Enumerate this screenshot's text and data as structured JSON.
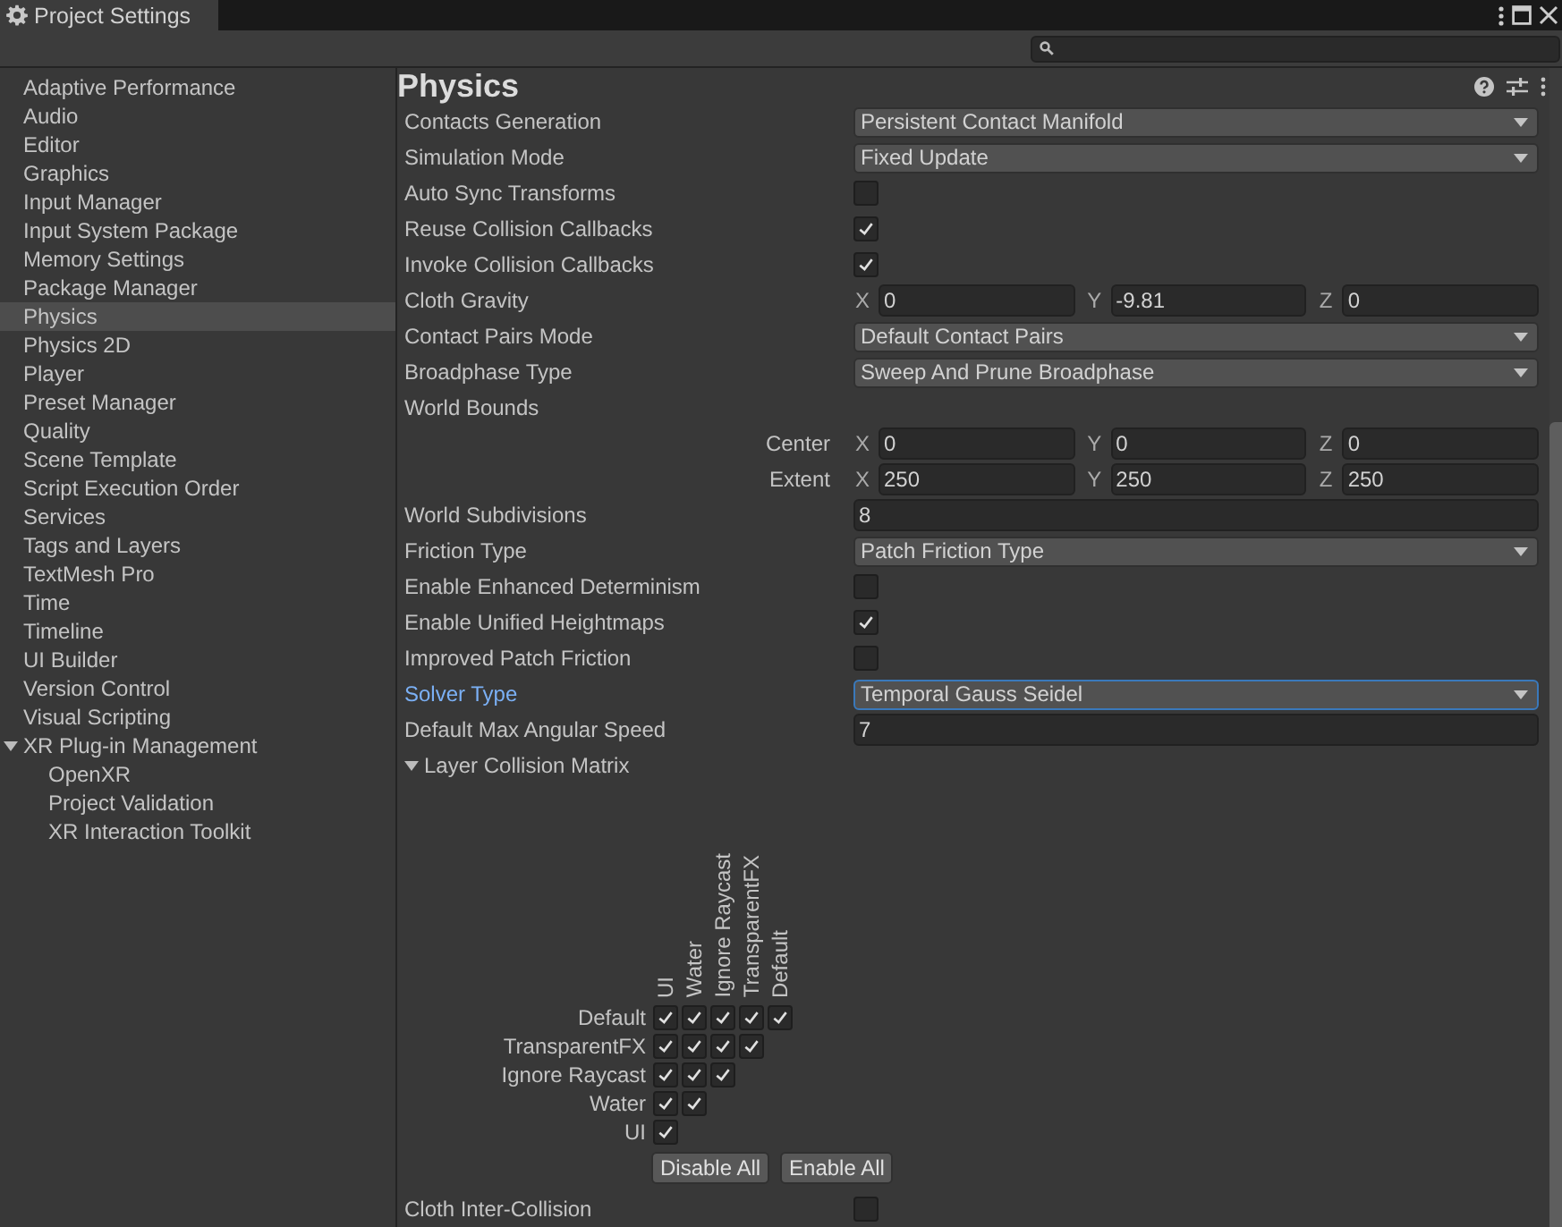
{
  "window": {
    "title": "Project Settings"
  },
  "sidebar": {
    "items": [
      {
        "label": "Adaptive Performance",
        "selected": false
      },
      {
        "label": "Audio",
        "selected": false
      },
      {
        "label": "Editor",
        "selected": false
      },
      {
        "label": "Graphics",
        "selected": false
      },
      {
        "label": "Input Manager",
        "selected": false
      },
      {
        "label": "Input System Package",
        "selected": false
      },
      {
        "label": "Memory Settings",
        "selected": false
      },
      {
        "label": "Package Manager",
        "selected": false
      },
      {
        "label": "Physics",
        "selected": true
      },
      {
        "label": "Physics 2D",
        "selected": false
      },
      {
        "label": "Player",
        "selected": false
      },
      {
        "label": "Preset Manager",
        "selected": false
      },
      {
        "label": "Quality",
        "selected": false
      },
      {
        "label": "Scene Template",
        "selected": false
      },
      {
        "label": "Script Execution Order",
        "selected": false
      },
      {
        "label": "Services",
        "selected": false
      },
      {
        "label": "Tags and Layers",
        "selected": false
      },
      {
        "label": "TextMesh Pro",
        "selected": false
      },
      {
        "label": "Time",
        "selected": false
      },
      {
        "label": "Timeline",
        "selected": false
      },
      {
        "label": "UI Builder",
        "selected": false
      },
      {
        "label": "Version Control",
        "selected": false
      },
      {
        "label": "Visual Scripting",
        "selected": false
      },
      {
        "label": "XR Plug-in Management",
        "selected": false,
        "expanded": true,
        "children": [
          {
            "label": "OpenXR",
            "selected": false
          },
          {
            "label": "Project Validation",
            "selected": false
          },
          {
            "label": "XR Interaction Toolkit",
            "selected": false
          }
        ]
      }
    ]
  },
  "inspector": {
    "title": "Physics",
    "rows": [
      {
        "kind": "dropdown",
        "label": "Contacts Generation",
        "value": "Persistent Contact Manifold",
        "focused": false
      },
      {
        "kind": "dropdown",
        "label": "Simulation Mode",
        "value": "Fixed Update",
        "focused": false
      },
      {
        "kind": "checkbox",
        "label": "Auto Sync Transforms",
        "checked": false
      },
      {
        "kind": "checkbox",
        "label": "Reuse Collision Callbacks",
        "checked": true
      },
      {
        "kind": "checkbox",
        "label": "Invoke Collision Callbacks",
        "checked": true
      },
      {
        "kind": "vector",
        "label": "Cloth Gravity",
        "axes": [
          {
            "axis": "X",
            "value": "0"
          },
          {
            "axis": "Y",
            "value": "-9.81"
          },
          {
            "axis": "Z",
            "value": "0"
          }
        ]
      },
      {
        "kind": "dropdown",
        "label": "Contact Pairs Mode",
        "value": "Default Contact Pairs",
        "focused": false
      },
      {
        "kind": "dropdown",
        "label": "Broadphase Type",
        "value": "Sweep And Prune Broadphase",
        "focused": false
      },
      {
        "kind": "heading",
        "label": "World Bounds"
      },
      {
        "kind": "subvector",
        "label": "Center",
        "axes": [
          {
            "axis": "X",
            "value": "0"
          },
          {
            "axis": "Y",
            "value": "0"
          },
          {
            "axis": "Z",
            "value": "0"
          }
        ]
      },
      {
        "kind": "subvector",
        "label": "Extent",
        "axes": [
          {
            "axis": "X",
            "value": "250"
          },
          {
            "axis": "Y",
            "value": "250"
          },
          {
            "axis": "Z",
            "value": "250"
          }
        ]
      },
      {
        "kind": "text",
        "label": "World Subdivisions",
        "value": "8"
      },
      {
        "kind": "dropdown",
        "label": "Friction Type",
        "value": "Patch Friction Type",
        "focused": false
      },
      {
        "kind": "checkbox",
        "label": "Enable Enhanced Determinism",
        "checked": false
      },
      {
        "kind": "checkbox",
        "label": "Enable Unified Heightmaps",
        "checked": true
      },
      {
        "kind": "checkbox",
        "label": "Improved Patch Friction",
        "checked": false
      },
      {
        "kind": "dropdown",
        "label": "Solver Type",
        "value": "Temporal Gauss Seidel",
        "focused": true
      },
      {
        "kind": "text",
        "label": "Default Max Angular Speed",
        "value": "7"
      }
    ],
    "collision_matrix": {
      "label": "Layer Collision Matrix",
      "expanded": true,
      "columns": [
        "UI",
        "Water",
        "Ignore Raycast",
        "TransparentFX",
        "Default"
      ],
      "rows": [
        {
          "label": "Default",
          "checks": [
            true,
            true,
            true,
            true,
            true
          ]
        },
        {
          "label": "TransparentFX",
          "checks": [
            true,
            true,
            true,
            true
          ]
        },
        {
          "label": "Ignore Raycast",
          "checks": [
            true,
            true,
            true
          ]
        },
        {
          "label": "Water",
          "checks": [
            true,
            true
          ]
        },
        {
          "label": "UI",
          "checks": [
            true
          ]
        }
      ],
      "buttons": [
        "Disable All",
        "Enable All"
      ]
    },
    "after_rows": [
      {
        "kind": "checkbox",
        "label": "Cloth Inter-Collision",
        "checked": false
      }
    ]
  }
}
